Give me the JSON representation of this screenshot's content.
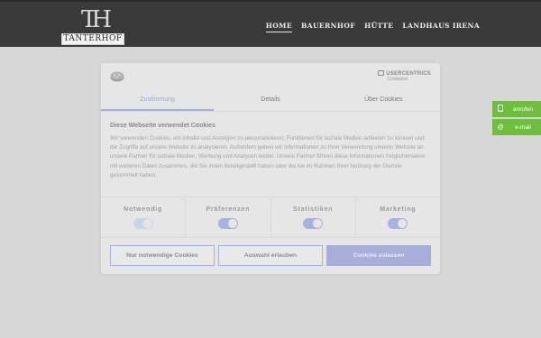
{
  "header": {
    "logo_monogram": "TH",
    "logo_text": "TANTERHOF",
    "nav": [
      {
        "label": "HOME",
        "active": true
      },
      {
        "label": "BAUERNHOF",
        "active": false
      },
      {
        "label": "HÜTTE",
        "active": false
      },
      {
        "label": "LANDHAUS IRENA",
        "active": false
      }
    ]
  },
  "side_buttons": [
    {
      "label": "anrufen",
      "icon": "phone-icon"
    },
    {
      "label": "e-mail",
      "icon": "at-icon"
    }
  ],
  "consent": {
    "brand_line1": "USERCENTRICS",
    "brand_line2": "Cookiebot",
    "tabs": [
      {
        "label": "Zustimmung",
        "active": true
      },
      {
        "label": "Details",
        "active": false
      },
      {
        "label": "Über Cookies",
        "active": false
      }
    ],
    "title": "Diese Webseite verwendet Cookies",
    "body": "Wir verwenden Cookies, um Inhalte und Anzeigen zu personalisieren, Funktionen für soziale Medien anbieten zu können und die Zugriffe auf unsere Website zu analysieren. Außerdem geben wir Informationen zu Ihrer Verwendung unserer Website an unsere Partner für soziale Medien, Werbung und Analysen weiter. Unsere Partner führen diese Informationen möglicherweise mit weiteren Daten zusammen, die Sie ihnen bereitgestellt haben oder die sie im Rahmen Ihrer Nutzung der Dienste gesammelt haben.",
    "toggles": [
      {
        "label": "Notwendig",
        "enabled": true,
        "locked": true
      },
      {
        "label": "Präferenzen",
        "enabled": true,
        "locked": false
      },
      {
        "label": "Statistiken",
        "enabled": true,
        "locked": false
      },
      {
        "label": "Marketing",
        "enabled": true,
        "locked": false
      }
    ],
    "buttons": {
      "necessary": "Nur notwendige Cookies",
      "selection": "Auswahl erlauben",
      "allow_all": "Cookies zulassen"
    }
  },
  "colors": {
    "accent": "#a7afd9",
    "side_green": "#6fbf3f",
    "header_bg": "#3a3a3a"
  }
}
